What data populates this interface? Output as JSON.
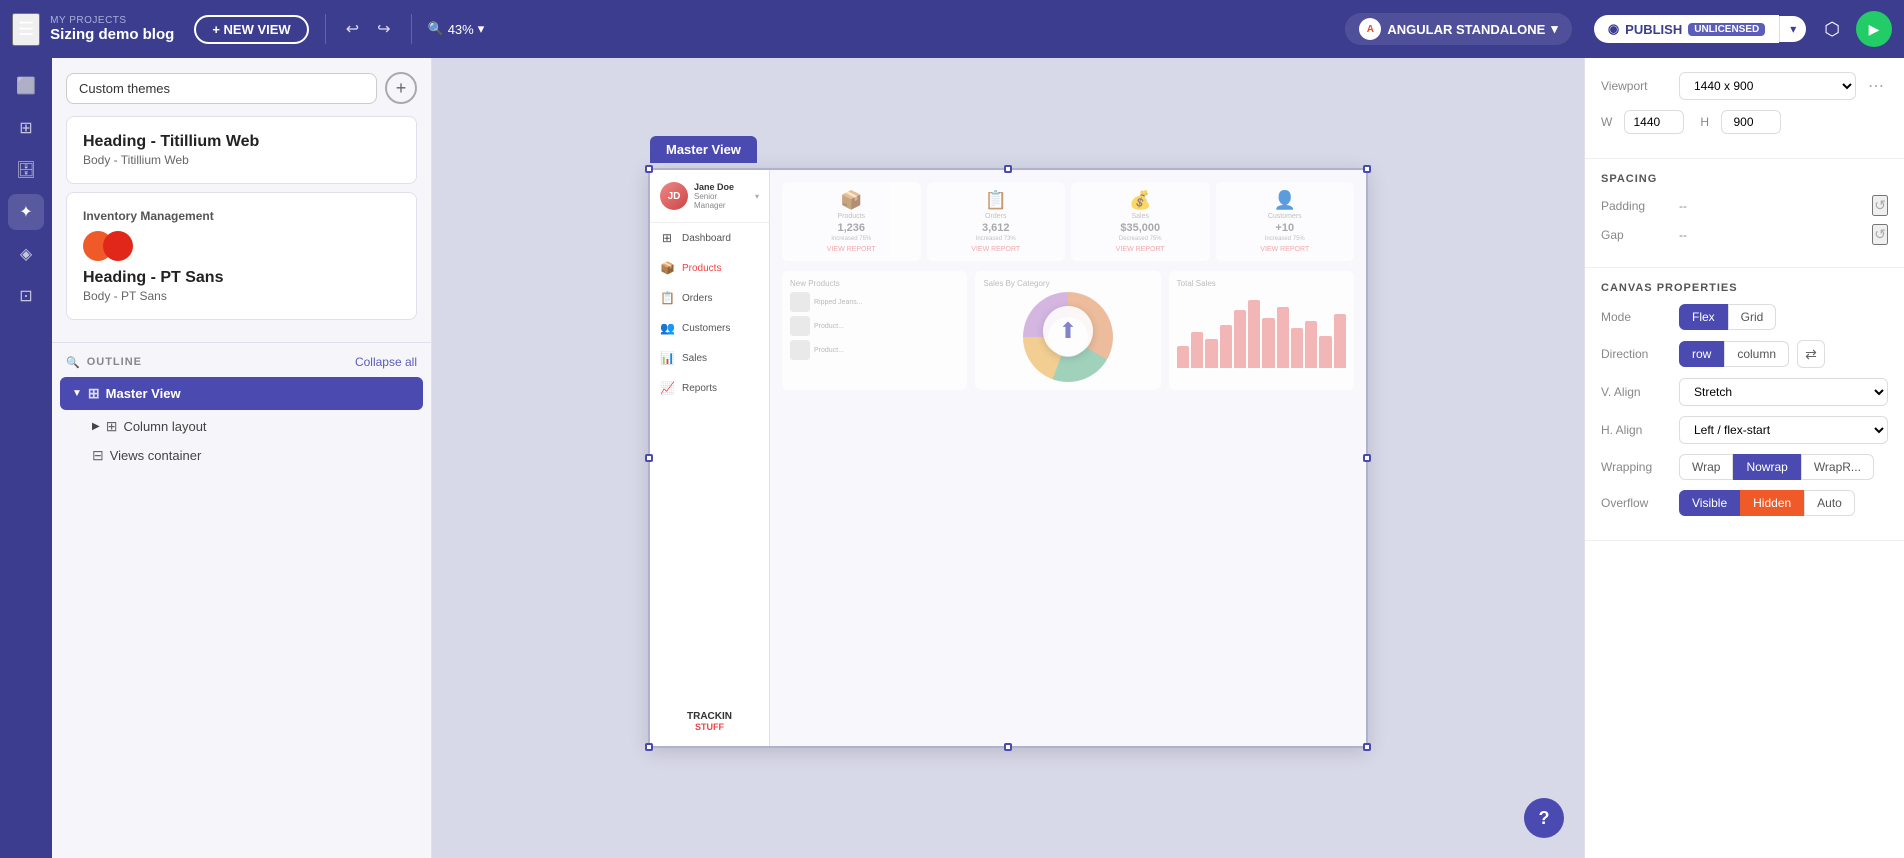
{
  "topbar": {
    "my_projects_label": "MY PROJECTS",
    "project_name": "Sizing demo blog",
    "new_view_btn": "+ NEW VIEW",
    "zoom_level": "43%",
    "framework_label": "ANGULAR STANDALONE",
    "publish_label": "PUBLISH",
    "publish_badge": "UNLICENSED",
    "share_icon": "⬡",
    "play_icon": "▶"
  },
  "left_panel": {
    "theme_section": {
      "dropdown_value": "Custom themes",
      "add_btn_icon": "+",
      "card1": {
        "heading": "Heading - Titillium Web",
        "body": "Body - Titillium Web"
      },
      "card2": {
        "title": "Inventory Management",
        "heading": "Heading - PT Sans",
        "body": "Body - PT Sans"
      }
    },
    "outline": {
      "title": "OUTLINE",
      "collapse_label": "Collapse all",
      "items": [
        {
          "label": "Master View",
          "type": "master",
          "expanded": true
        },
        {
          "label": "Column layout",
          "type": "child",
          "indent": 1
        },
        {
          "label": "Views container",
          "type": "child",
          "indent": 1
        }
      ]
    }
  },
  "dashboard_preview": {
    "master_view_tab": "Master View",
    "sidebar": {
      "user_name": "Jane Doe",
      "user_role": "Senior Manager",
      "nav_items": [
        {
          "label": "Dashboard",
          "icon": "⊞"
        },
        {
          "label": "Products",
          "icon": "📦"
        },
        {
          "label": "Orders",
          "icon": "📋"
        },
        {
          "label": "Customers",
          "icon": "👥"
        },
        {
          "label": "Sales",
          "icon": "📊"
        },
        {
          "label": "Reports",
          "icon": "📈"
        }
      ],
      "brand_name": "TRACKIN",
      "brand_sub": "STUFF"
    },
    "stats": [
      {
        "label": "Products",
        "value": "1,236",
        "change": "Increased 75%",
        "link": "VIEW REPORT"
      },
      {
        "label": "Orders",
        "value": "3,612",
        "change": "Increased 73%",
        "link": "VIEW REPORT"
      },
      {
        "label": "Sales",
        "value": "$35,000",
        "change": "Decreased 75%",
        "link": "VIEW REPORT"
      },
      {
        "label": "Customers",
        "value": "+10",
        "change": "Increased 75%",
        "link": "VIEW REPORT"
      }
    ],
    "bottom_sections": {
      "new_products": "New Products",
      "sales_by_category": "Sales By Category",
      "total_sales": "Total Sales"
    }
  },
  "right_panel": {
    "viewport_label": "Viewport",
    "viewport_value": "1440 x 900",
    "w_label": "W",
    "w_value": "1440",
    "h_label": "H",
    "h_value": "900",
    "spacing_title": "SPACING",
    "padding_label": "Padding",
    "padding_value": "--",
    "gap_label": "Gap",
    "gap_value": "--",
    "canvas_title": "CANVAS PROPERTIES",
    "mode_label": "Mode",
    "mode_flex": "Flex",
    "mode_grid": "Grid",
    "direction_label": "Direction",
    "direction_row": "row",
    "direction_column": "column",
    "valign_label": "V. Align",
    "valign_value": "Stretch",
    "halign_label": "H. Align",
    "halign_value": "Left / flex-start",
    "wrapping_label": "Wrapping",
    "wrap_btn": "Wrap",
    "nowrap_btn": "Nowrap",
    "wraprev_btn": "WrapR...",
    "overflow_label": "Overflow",
    "visible_btn": "Visible",
    "hidden_btn": "Hidden",
    "auto_btn": "Auto"
  },
  "help_btn": "?"
}
